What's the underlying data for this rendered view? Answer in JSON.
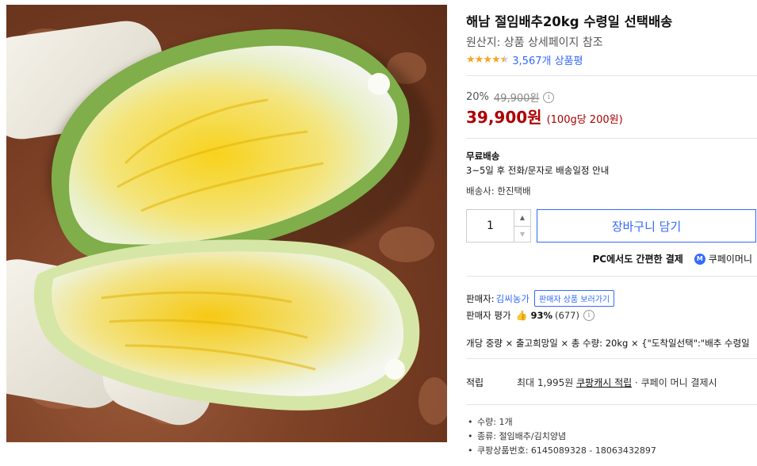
{
  "product": {
    "title": "해남 절임배추20kg 수령일 선택배송",
    "origin": "원산지: 상품 상세페이지 참조",
    "rating_stars": 4.5,
    "review_count": "3,567개 상품평"
  },
  "price": {
    "discount": "20%",
    "original": "49,900원",
    "sale": "39,900원",
    "unit": "(100g당 200원)"
  },
  "shipping": {
    "title": "무료배송",
    "desc": "3~5일 후 전화/문자로 배송일정 안내",
    "courier": "배송사: 한진택배"
  },
  "purchase": {
    "quantity": "1",
    "cart_label": "장바구니 담기",
    "pc_pay_prefix": "PC에서도 간편한 결제",
    "cpay_label": "쿠페이머니",
    "cpay_icon_letter": "M"
  },
  "seller": {
    "label": "판매자:",
    "name": "김씨농가",
    "tooltip": "판매자 상품 보러가기",
    "eval_label": "판매자 평가",
    "eval_pct": "93%",
    "eval_count": "(677)"
  },
  "options": {
    "line": "개당 중량 × 출고희망일 × 총 수량: 20kg × {\"도착일선택\":\"배추 수령일"
  },
  "points": {
    "label": "적립",
    "prefix": "최대 1,995원 ",
    "link": "쿠팡캐시 적립",
    "suffix": " · 쿠페이 머니 결제시"
  },
  "bullets": [
    "수량: 1개",
    "종류: 절임배추/김치양념",
    "쿠팡상품번호: 6145089328 - 18063432897"
  ],
  "colors": {
    "accent": "#346aff",
    "price": "#ae0000",
    "star": "#f5a623"
  }
}
